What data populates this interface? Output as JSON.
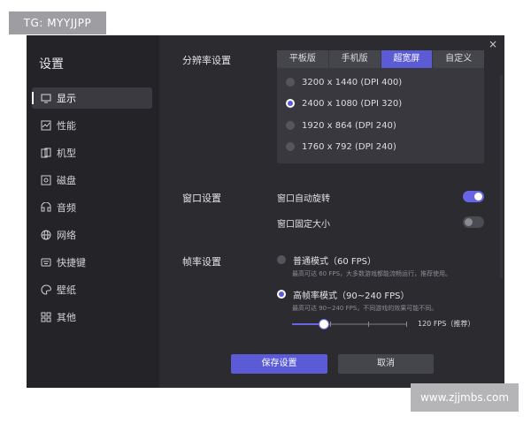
{
  "watermarks": {
    "top": "TG: MYYJJPP",
    "bottom": "www.zjjmbs.com"
  },
  "sidebar": {
    "title": "设置",
    "items": [
      {
        "label": "显示",
        "icon": "monitor-icon",
        "active": true
      },
      {
        "label": "性能",
        "icon": "performance-icon",
        "active": false
      },
      {
        "label": "机型",
        "icon": "phone-model-icon",
        "active": false
      },
      {
        "label": "磁盘",
        "icon": "disk-icon",
        "active": false
      },
      {
        "label": "音频",
        "icon": "audio-icon",
        "active": false
      },
      {
        "label": "网络",
        "icon": "globe-icon",
        "active": false
      },
      {
        "label": "快捷键",
        "icon": "keyboard-icon",
        "active": false
      },
      {
        "label": "壁纸",
        "icon": "palette-icon",
        "active": false
      },
      {
        "label": "其他",
        "icon": "grid-icon",
        "active": false
      }
    ]
  },
  "close_icon": "×",
  "resolution": {
    "label": "分辨率设置",
    "tabs": [
      {
        "label": "平板版",
        "active": false
      },
      {
        "label": "手机版",
        "active": false
      },
      {
        "label": "超宽屏",
        "active": true
      },
      {
        "label": "自定义",
        "active": false
      }
    ],
    "options": [
      {
        "label": "3200 x 1440  (DPI 400)",
        "checked": false
      },
      {
        "label": "2400 x 1080  (DPI 320)",
        "checked": true
      },
      {
        "label": "1920 x 864  (DPI 240)",
        "checked": false
      },
      {
        "label": "1760 x 792  (DPI 240)",
        "checked": false
      }
    ]
  },
  "window_settings": {
    "label": "窗口设置",
    "toggles": [
      {
        "label": "窗口自动旋转",
        "on": true
      },
      {
        "label": "窗口固定大小",
        "on": false
      }
    ]
  },
  "frame_rate": {
    "label": "帧率设置",
    "options": [
      {
        "label": "普通模式（60 FPS）",
        "desc": "最高可达 60 FPS，大多数游戏都能流畅运行，推荐使用。",
        "checked": false
      },
      {
        "label": "高帧率模式（90~240 FPS）",
        "desc": "最高可达 90~240 FPS，不同游戏的效果可能不同。",
        "checked": true
      }
    ],
    "slider_value_text": "120 FPS（推荐）",
    "slider_fraction": 0.28
  },
  "buttons": {
    "save": "保存设置",
    "cancel": "取消"
  },
  "colors": {
    "accent": "#5c5bd6",
    "window_bg": "#2b2b30",
    "sidebar_bg": "#242428"
  }
}
